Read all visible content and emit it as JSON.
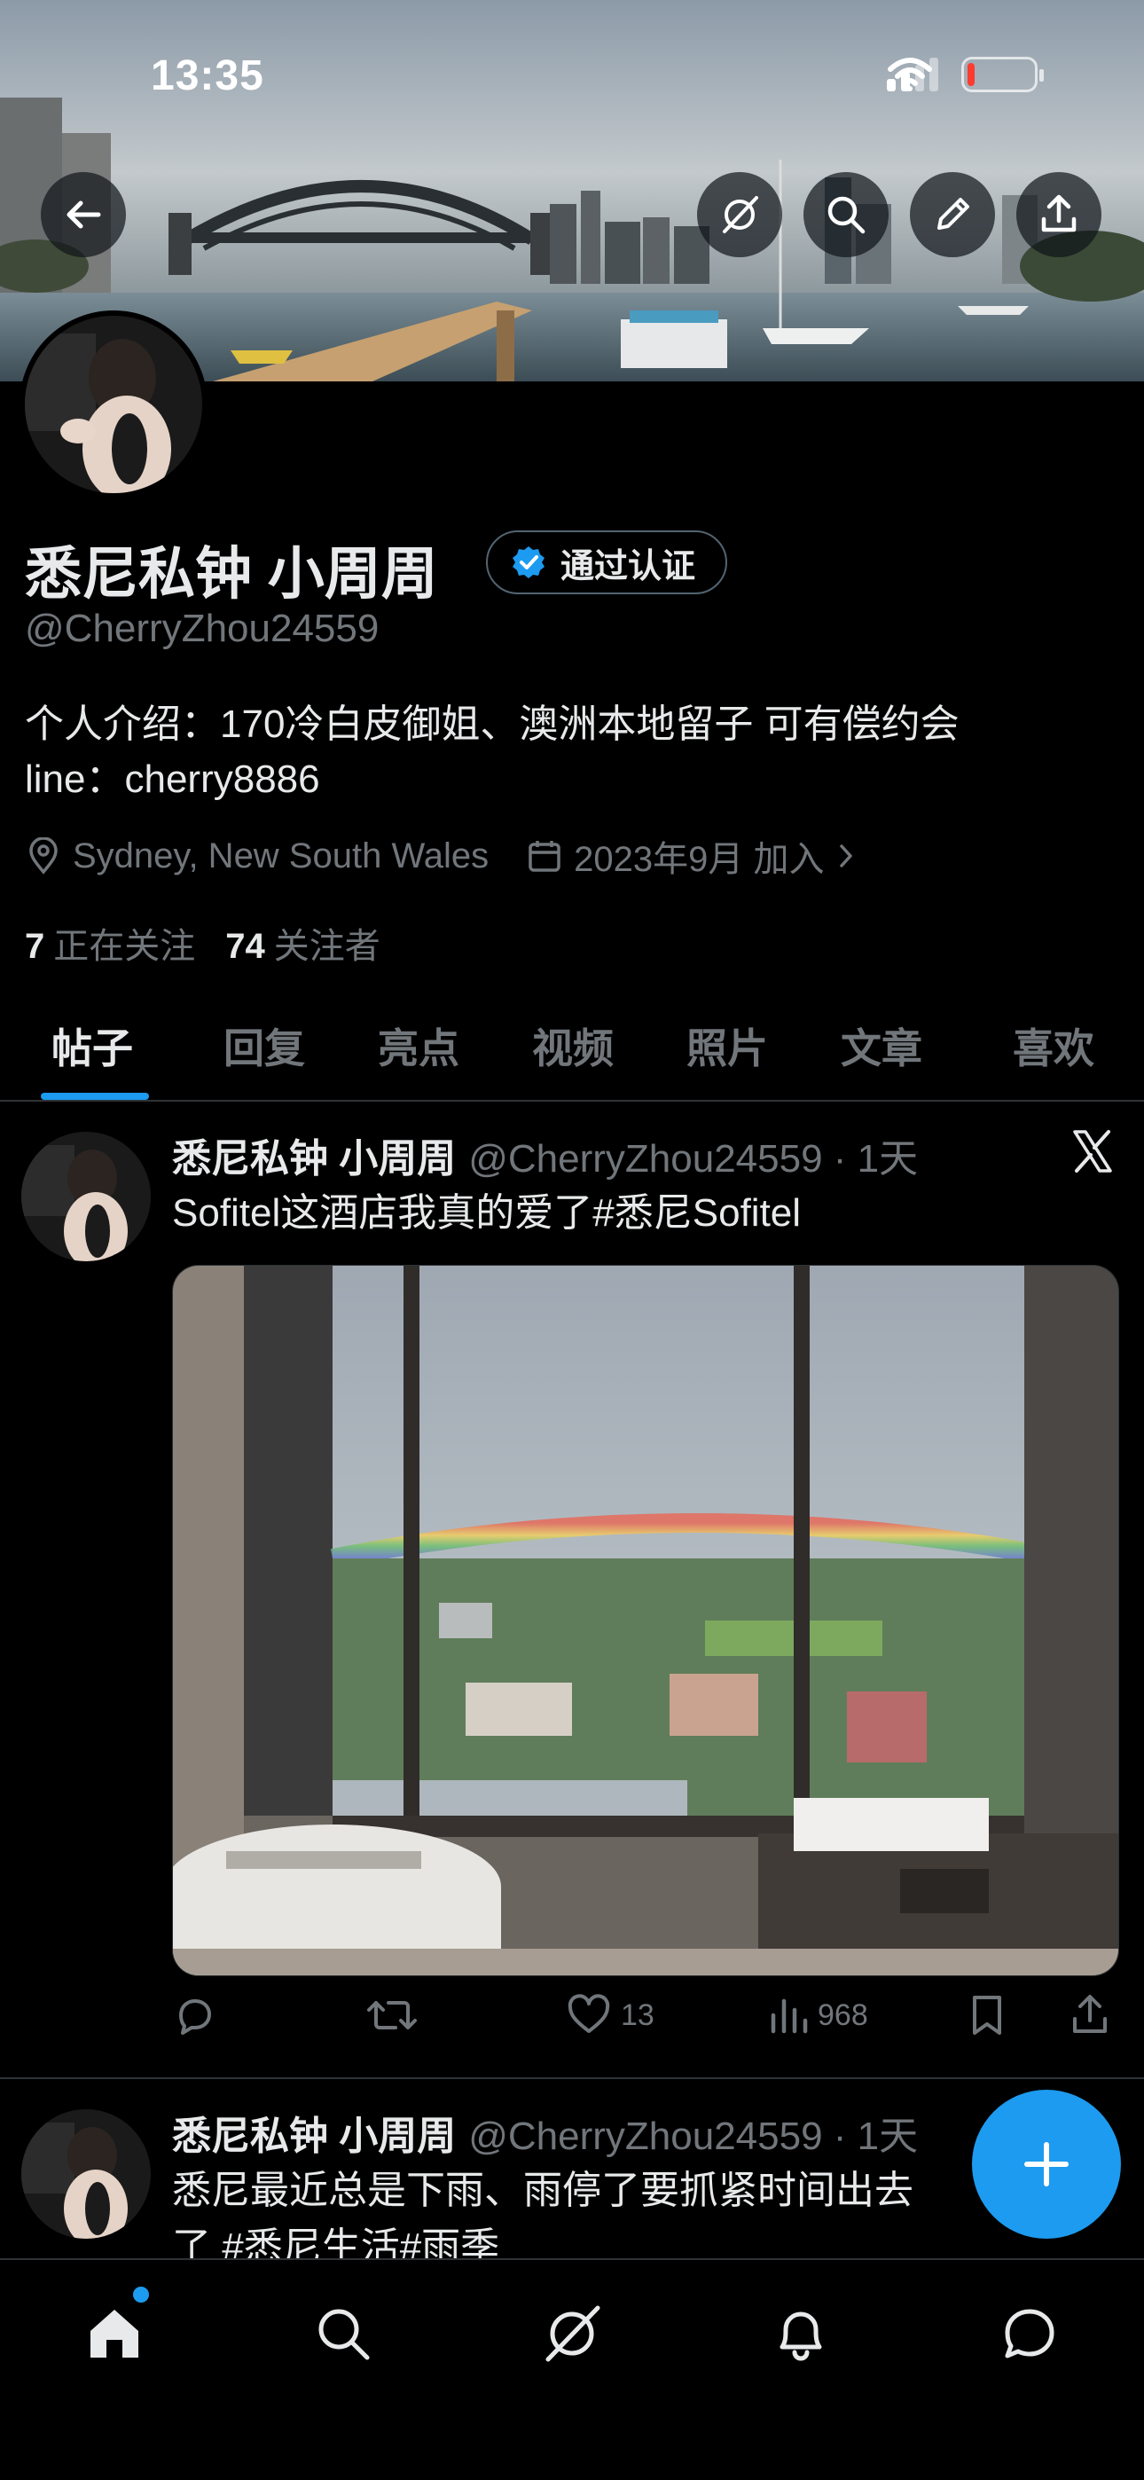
{
  "status_bar": {
    "time": "13:35"
  },
  "banner": {
    "alt": "Sydney Harbour Bridge skyline"
  },
  "profile": {
    "display_name": "悉尼私钟 小周周",
    "verified_label": "通过认证",
    "handle": "@CherryZhou24559",
    "bio_line1": "个人介绍：170冷白皮御姐、澳洲本地留子 可有偿约会",
    "bio_line2": "line：cherry8886",
    "location": "Sydney, New South Wales",
    "joined": "2023年9月 加入",
    "following_count": "7",
    "following_label": "正在关注",
    "followers_count": "74",
    "followers_label": "关注者"
  },
  "tabs": [
    "帖子",
    "回复",
    "亮点",
    "视频",
    "照片",
    "文章",
    "喜欢"
  ],
  "posts": [
    {
      "name": "悉尼私钟 小周周",
      "handle_time": "@CherryZhou24559 · 1天",
      "text": "Sofitel这酒店我真的爱了#悉尼Sofitel",
      "likes": "13",
      "views": "968"
    },
    {
      "name": "悉尼私钟 小周周",
      "handle_time": "@CherryZhou24559 · 1天",
      "text_line1": "悉尼最近总是下雨、雨停了要抓紧时间出去",
      "text_line2": "了 #悉尼生活#雨季"
    }
  ],
  "colors": {
    "accent": "#1d9bf0",
    "background": "#000000",
    "secondary_text": "#71767b"
  }
}
